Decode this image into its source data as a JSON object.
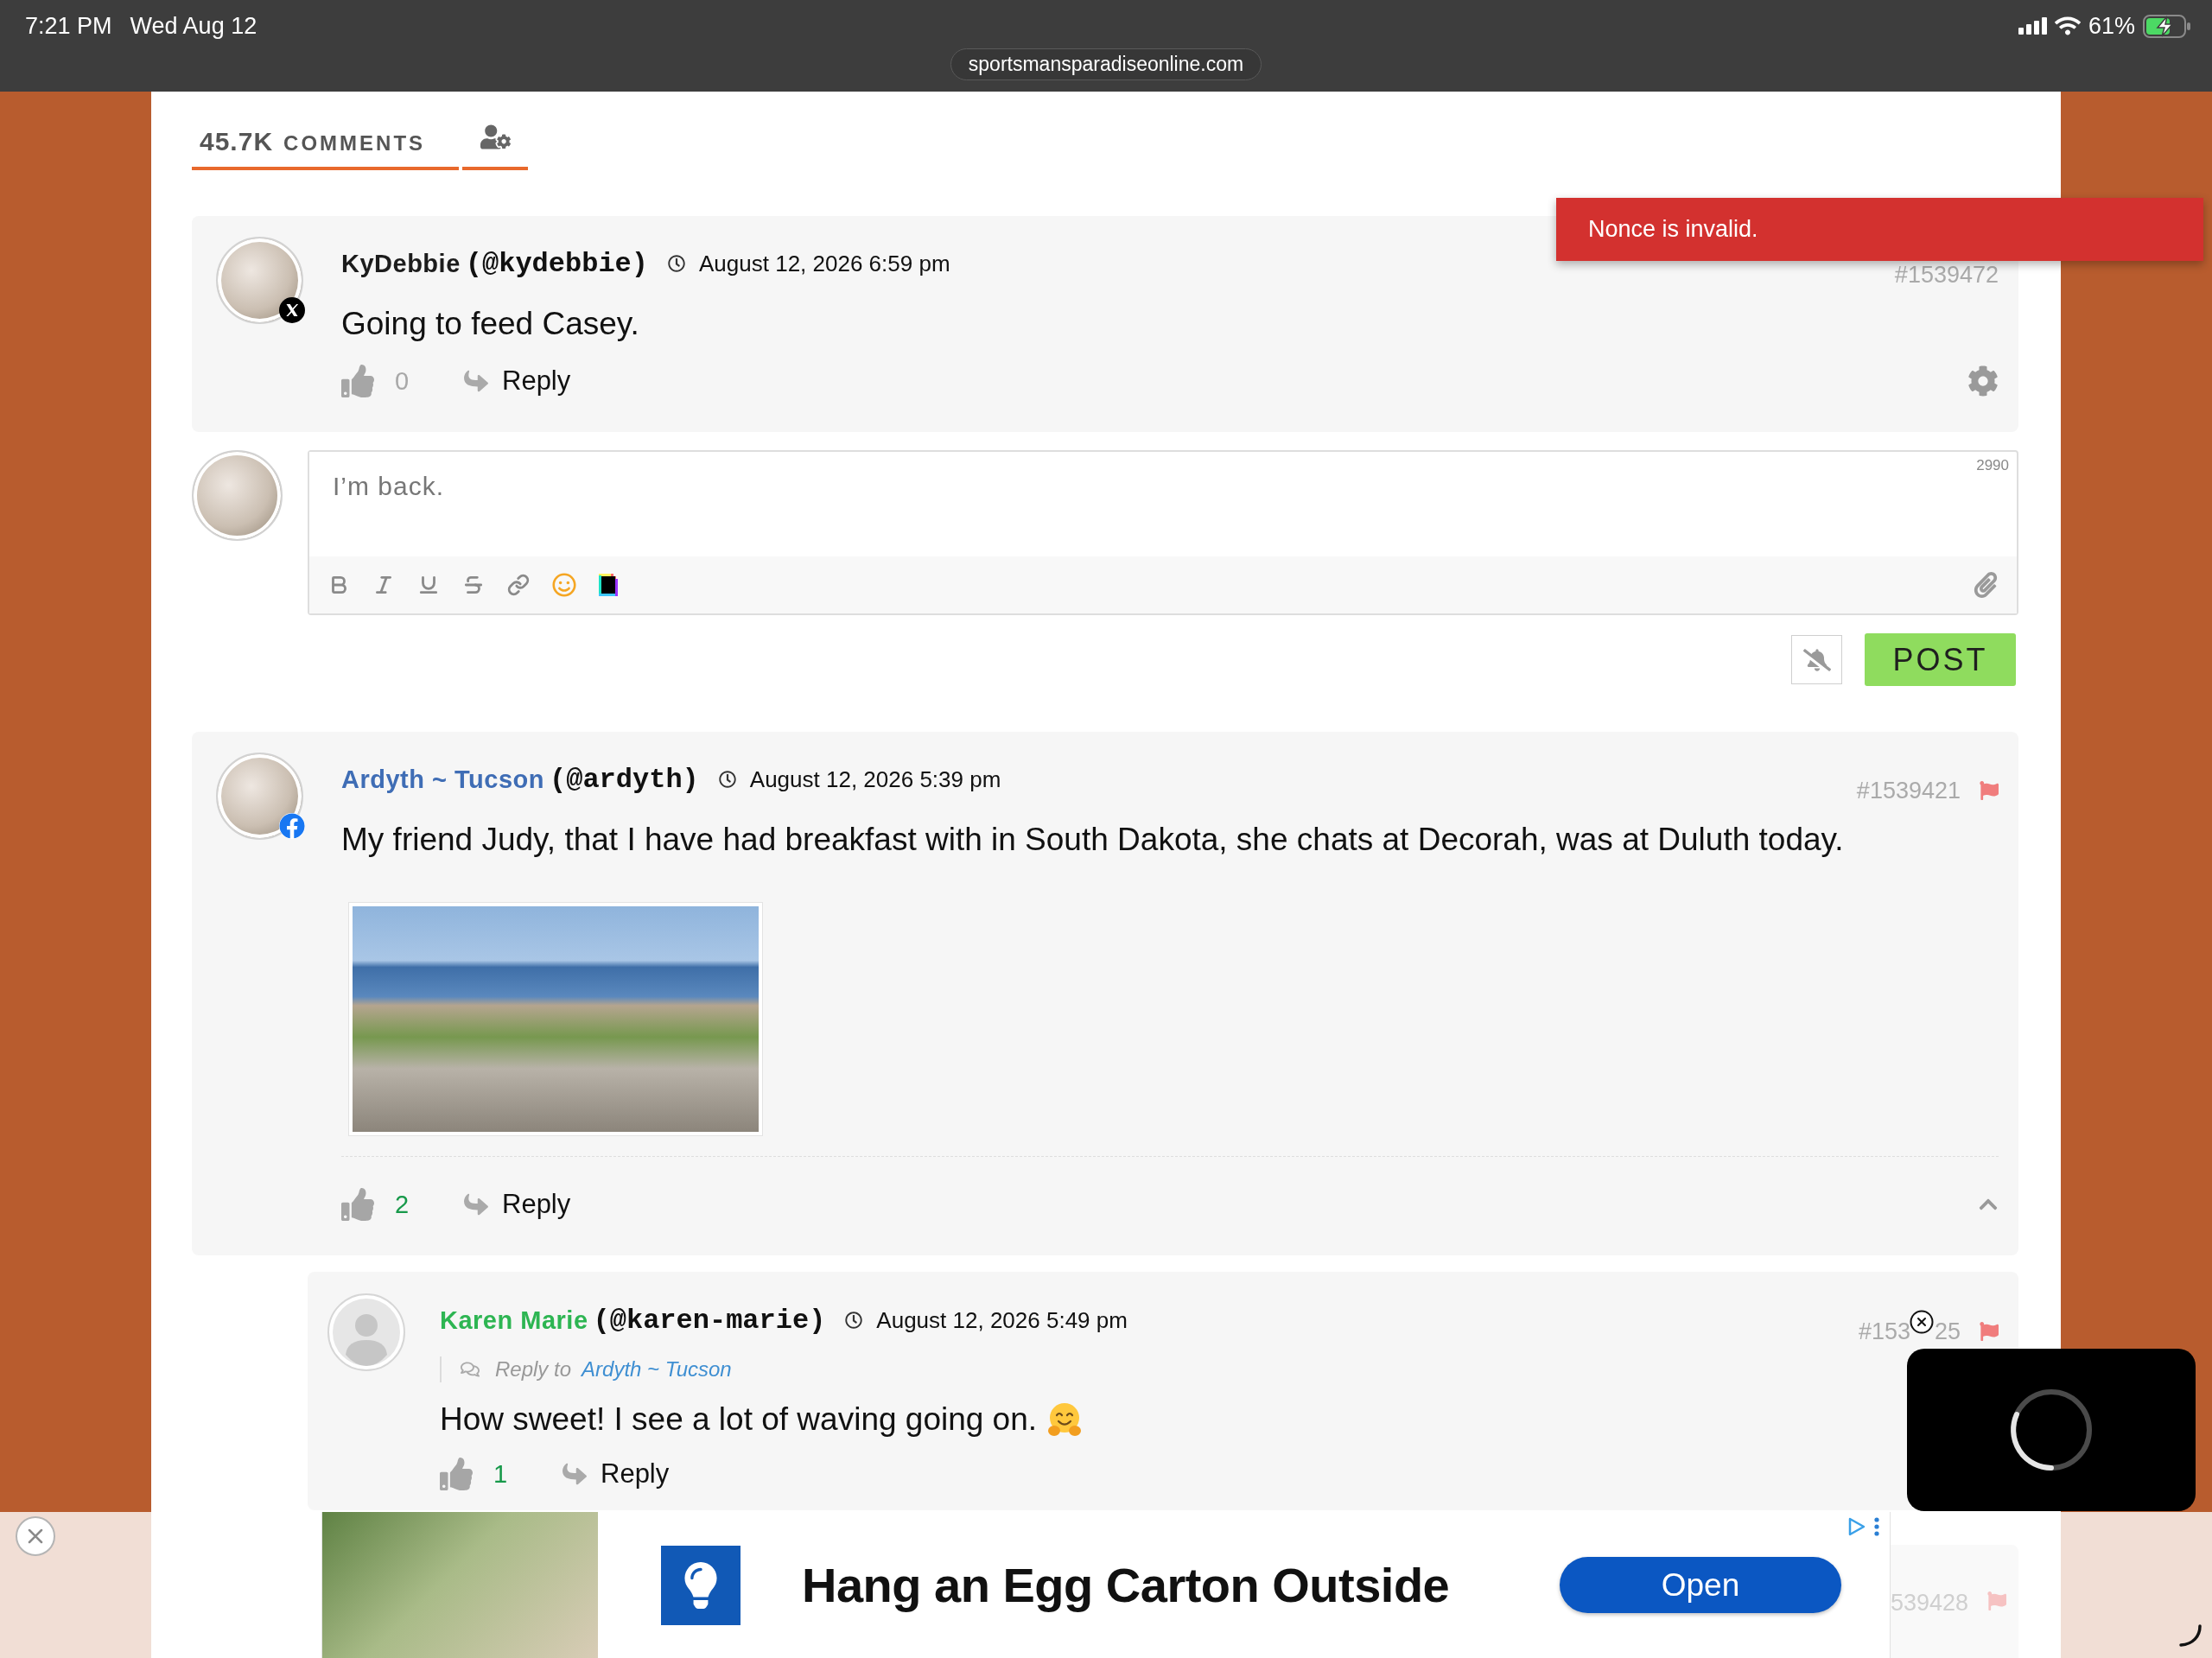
{
  "status_bar": {
    "time": "7:21 PM",
    "date": "Wed Aug 12",
    "url": "sportsmansparadiseonline.com",
    "battery": "61%"
  },
  "comments_header": {
    "count": "45.7K",
    "label": "COMMENTS"
  },
  "toast": {
    "message": "Nonce is invalid."
  },
  "comments": [
    {
      "kind": "full",
      "author": "KyDebbie",
      "handle": "(@kydebbie)",
      "color": "#1c1c1c",
      "avatar": {
        "kind": "photo"
      },
      "badge": {
        "kind": "x"
      },
      "time": "August 12, 2026 6:59 pm",
      "id": "#1539472",
      "text": "Going to feed Casey.",
      "votes": {
        "count": "0",
        "positive": false
      },
      "reply_label": "Reply",
      "flaggable": false,
      "settings": true,
      "reply_form": {
        "avatar": {
          "kind": "photo"
        },
        "value": "I’m back.",
        "counter": "2990",
        "post_label": "POST"
      }
    },
    {
      "kind": "full",
      "author": "Ardyth ~ Tucson",
      "handle": "(@ardyth)",
      "color": "#3f6db5",
      "avatar": {
        "kind": "photo"
      },
      "badge": {
        "kind": "facebook"
      },
      "time": "August 12, 2026 5:39 pm",
      "id": "#1539421",
      "text": "My friend Judy, that I have had breakfast with in South Dakota, she chats at Decorah, was at Duluth today.",
      "attachments": [
        {
          "kind": "photo"
        }
      ],
      "votes": {
        "count": "2",
        "positive": true
      },
      "reply_label": "Reply",
      "flaggable": true,
      "settings": false,
      "expanded": true,
      "children": [
        {
          "kind": "full",
          "author": "Karen Marie",
          "handle": "(@karen-marie)",
          "color": "#2db552",
          "avatar": {
            "kind": "default"
          },
          "time": "August 12, 2026 5:49 pm",
          "id_parts": [
            "#153",
            "25"
          ],
          "reply_to": {
            "label": "Reply to",
            "name": "Ardyth ~ Tucson"
          },
          "text": "How sweet! I see a lot of waving going on.",
          "emoji": true,
          "votes": {
            "count": "1",
            "positive": true
          },
          "reply_label": "Reply",
          "flaggable": true,
          "settings": false
        },
        {
          "kind": "peek",
          "id": "539428",
          "flaggable": true
        }
      ]
    }
  ],
  "ad": {
    "headline": "Hang an Egg Carton Outside",
    "button": "Open"
  }
}
